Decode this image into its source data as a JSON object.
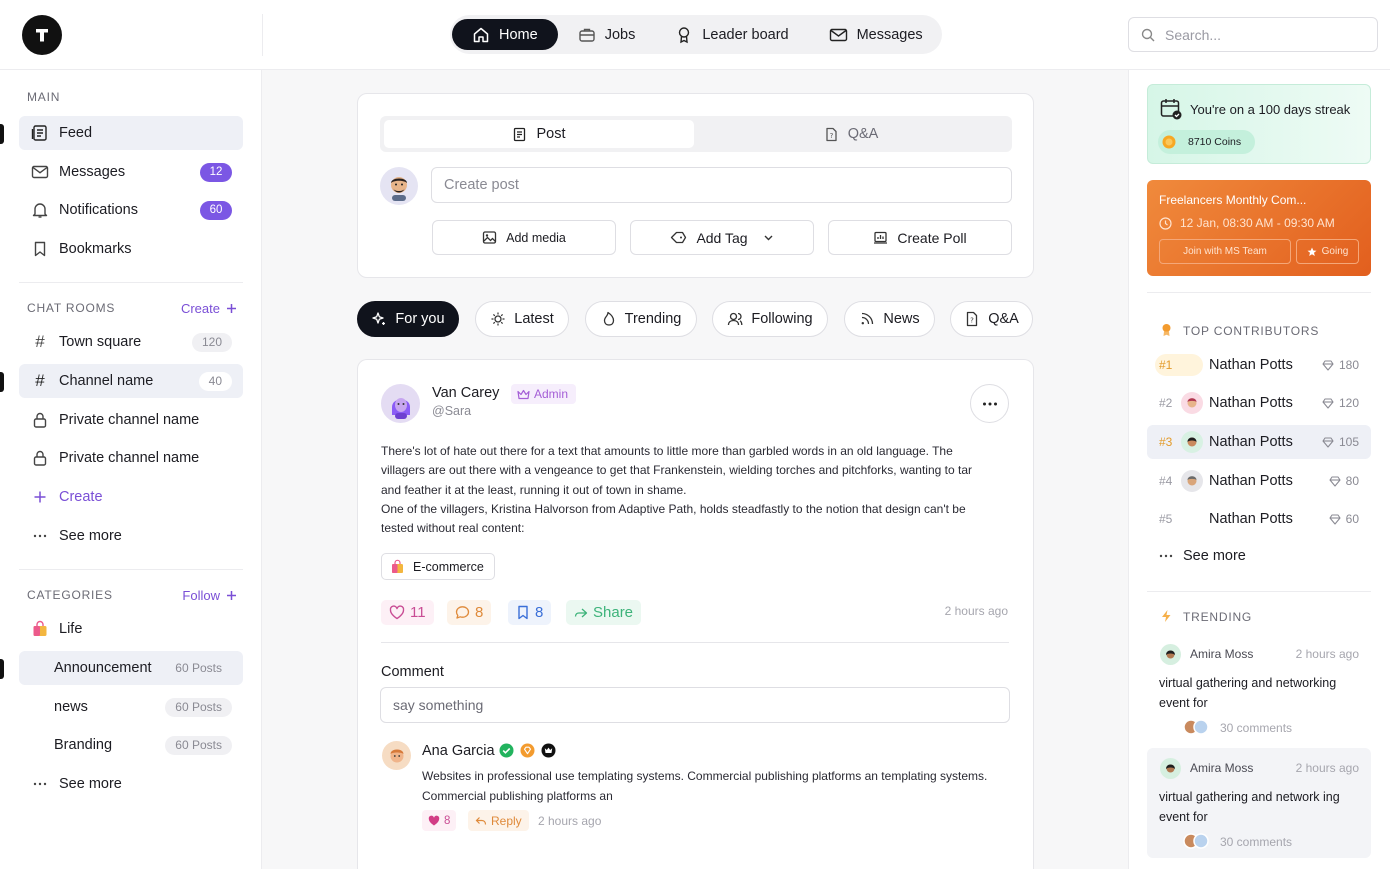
{
  "nav": {
    "tabs": [
      {
        "label": "Home",
        "active": true
      },
      {
        "label": "Jobs",
        "active": false
      },
      {
        "label": "Leader board",
        "active": false
      },
      {
        "label": "Messages",
        "active": false
      }
    ],
    "search_placeholder": "Search..."
  },
  "sidebar": {
    "main_title": "MAIN",
    "main_items": [
      {
        "label": "Feed",
        "selected": true,
        "icon": "feed-icon"
      },
      {
        "label": "Messages",
        "badge": "12",
        "icon": "mail-icon"
      },
      {
        "label": "Notifications",
        "badge": "60",
        "icon": "bell-icon"
      },
      {
        "label": "Bookmarks",
        "icon": "bookmark-icon"
      }
    ],
    "chat_title": "CHAT ROOMS",
    "chat_action": "Create",
    "chat_items": [
      {
        "label": "Town square",
        "count": "120",
        "icon": "hash-icon"
      },
      {
        "label": "Channel name",
        "count": "40",
        "icon": "hash-icon",
        "selected": true
      },
      {
        "label": "Private channel name",
        "icon": "lock-icon"
      },
      {
        "label": "Private channel name",
        "icon": "lock-icon"
      },
      {
        "label": "Create",
        "icon": "plus-icon"
      },
      {
        "label": "See more",
        "icon": "more-icon"
      }
    ],
    "cat_title": "CATEGORIES",
    "cat_action": "Follow",
    "cat_items": [
      {
        "label": "Life",
        "icon": "bag-icon"
      },
      {
        "label": "Announcement",
        "count": "60 Posts",
        "selected": true
      },
      {
        "label": "news",
        "count": "60 Posts"
      },
      {
        "label": "Branding",
        "count": "60 Posts"
      },
      {
        "label": "See more",
        "icon": "more-icon"
      }
    ]
  },
  "composer": {
    "tab_post": "Post",
    "tab_qa": "Q&A",
    "placeholder": "Create post",
    "add_media": "Add media",
    "add_tag": "Add Tag",
    "create_poll": "Create Poll"
  },
  "filters": [
    "For you",
    "Latest",
    "Trending",
    "Following",
    "News",
    "Q&A"
  ],
  "post": {
    "author": "Van Carey",
    "role": "Admin",
    "handle": "@Sara",
    "body": [
      "There's lot of hate out there for a text that amounts to little more than garbled words in an old language. The",
      "villagers are out there with a vengeance to get that Frankenstein, wielding torches and pitchforks, wanting to tar",
      "and feather it at the least, running it out of town in shame.",
      "One of the villagers, Kristina Halvorson from Adaptive Path, holds steadfastly to the notion that design can't be",
      "tested without real content:"
    ],
    "tag": "E-commerce",
    "likes": "11",
    "comments": "8",
    "bookmarks": "8",
    "share": "Share",
    "time": "2 hours ago",
    "comment_label": "Comment",
    "comment_placeholder": "say something"
  },
  "reply": {
    "author": "Ana Garcia",
    "body": [
      "Websites in professional use templating systems. Commercial publishing platforms an templating systems.",
      "Commercial publishing platforms an"
    ],
    "likes": "8",
    "reply_label": "Reply",
    "time": "2 hours ago"
  },
  "streak": {
    "text": "You're on a 100 days streak",
    "coins": "8710 Coins"
  },
  "event": {
    "title": "Freelancers Monthly Com...",
    "time": "12 Jan, 08:30 AM - 09:30 AM",
    "join": "Join with MS Team",
    "going": "Going"
  },
  "contributors": {
    "title": "TOP CONTRIBUTORS",
    "rows": [
      {
        "rank": "#1",
        "name": "Nathan Potts",
        "points": "180"
      },
      {
        "rank": "#2",
        "name": "Nathan Potts",
        "points": "120"
      },
      {
        "rank": "#3",
        "name": "Nathan Potts",
        "points": "105"
      },
      {
        "rank": "#4",
        "name": "Nathan Potts",
        "points": "80"
      },
      {
        "rank": "#5",
        "name": "Nathan Potts",
        "points": "60"
      }
    ],
    "see_more": "See more"
  },
  "trending": {
    "title": "TRENDING",
    "items": [
      {
        "author": "Amira Moss",
        "time": "2 hours ago",
        "text1": "virtual gathering and networking",
        "text2": "event for",
        "comments": "30 comments"
      },
      {
        "author": "Amira Moss",
        "time": "2 hours ago",
        "text1": "virtual gathering and network ing",
        "text2": "event for",
        "comments": "30 comments"
      }
    ]
  },
  "colors": {
    "accent": "#7b57e4",
    "dark": "#10131c",
    "orange": "#e8722b",
    "green": "#d9f7ea"
  }
}
